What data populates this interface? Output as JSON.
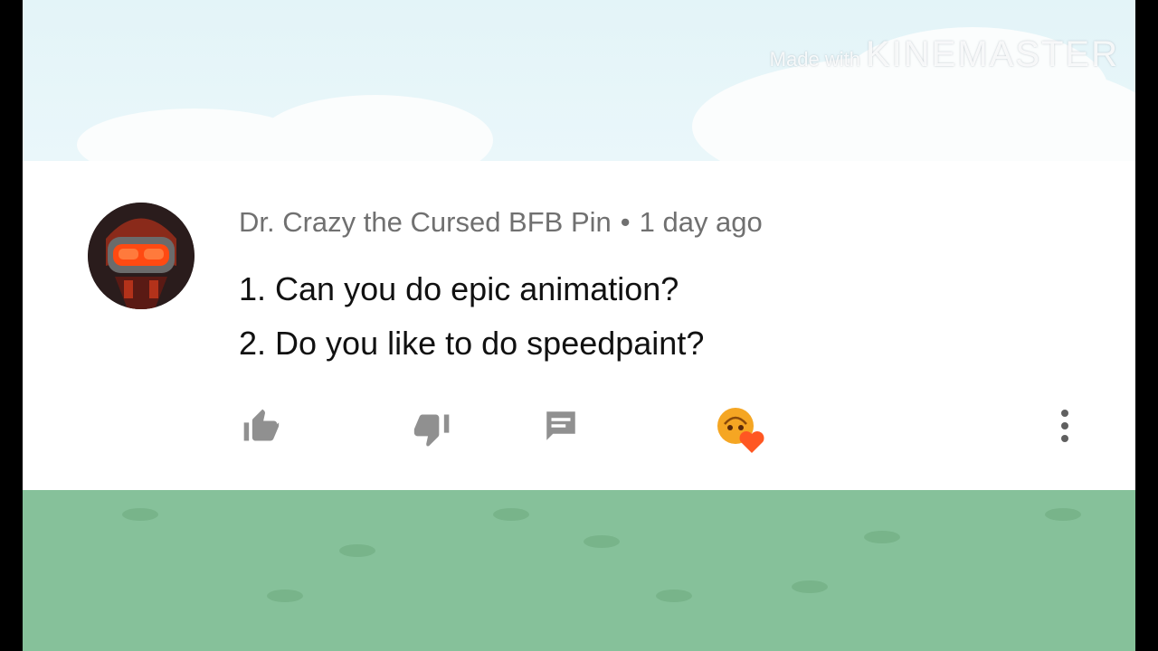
{
  "watermark": {
    "prefix": "Made with",
    "brand": "KINEMASTER"
  },
  "comment": {
    "author": "Dr. Crazy the Cursed BFB Pin",
    "separator": "•",
    "timestamp": "1 day ago",
    "lines": [
      "1. Can you do epic animation?",
      "2. Do you like to do speedpaint?"
    ]
  },
  "actions": {
    "like_icon": "thumbs-up-icon",
    "dislike_icon": "thumbs-down-icon",
    "reply_icon": "comment-icon",
    "creator_heart_icon": "creator-heart-icon",
    "more_icon": "more-vertical-icon"
  },
  "colors": {
    "card_background": "#ffffff",
    "grass": "#86c19a",
    "sky": "#e3f4f8",
    "icon_gray": "#909090",
    "heart": "#ff5722",
    "heart_badge": "#f5a623"
  }
}
